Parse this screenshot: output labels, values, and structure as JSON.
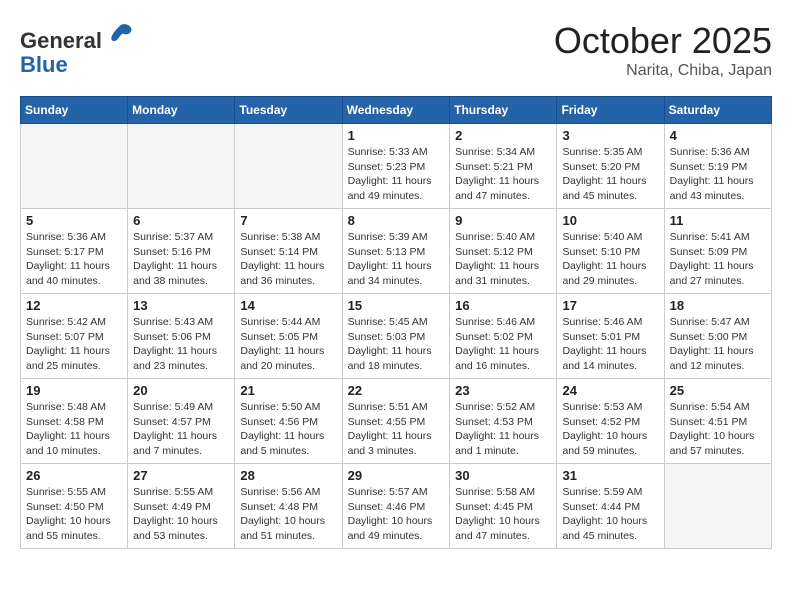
{
  "header": {
    "logo_general": "General",
    "logo_blue": "Blue",
    "month_title": "October 2025",
    "location": "Narita, Chiba, Japan"
  },
  "days_of_week": [
    "Sunday",
    "Monday",
    "Tuesday",
    "Wednesday",
    "Thursday",
    "Friday",
    "Saturday"
  ],
  "weeks": [
    [
      {
        "day": "",
        "info": ""
      },
      {
        "day": "",
        "info": ""
      },
      {
        "day": "",
        "info": ""
      },
      {
        "day": "1",
        "info": "Sunrise: 5:33 AM\nSunset: 5:23 PM\nDaylight: 11 hours\nand 49 minutes."
      },
      {
        "day": "2",
        "info": "Sunrise: 5:34 AM\nSunset: 5:21 PM\nDaylight: 11 hours\nand 47 minutes."
      },
      {
        "day": "3",
        "info": "Sunrise: 5:35 AM\nSunset: 5:20 PM\nDaylight: 11 hours\nand 45 minutes."
      },
      {
        "day": "4",
        "info": "Sunrise: 5:36 AM\nSunset: 5:19 PM\nDaylight: 11 hours\nand 43 minutes."
      }
    ],
    [
      {
        "day": "5",
        "info": "Sunrise: 5:36 AM\nSunset: 5:17 PM\nDaylight: 11 hours\nand 40 minutes."
      },
      {
        "day": "6",
        "info": "Sunrise: 5:37 AM\nSunset: 5:16 PM\nDaylight: 11 hours\nand 38 minutes."
      },
      {
        "day": "7",
        "info": "Sunrise: 5:38 AM\nSunset: 5:14 PM\nDaylight: 11 hours\nand 36 minutes."
      },
      {
        "day": "8",
        "info": "Sunrise: 5:39 AM\nSunset: 5:13 PM\nDaylight: 11 hours\nand 34 minutes."
      },
      {
        "day": "9",
        "info": "Sunrise: 5:40 AM\nSunset: 5:12 PM\nDaylight: 11 hours\nand 31 minutes."
      },
      {
        "day": "10",
        "info": "Sunrise: 5:40 AM\nSunset: 5:10 PM\nDaylight: 11 hours\nand 29 minutes."
      },
      {
        "day": "11",
        "info": "Sunrise: 5:41 AM\nSunset: 5:09 PM\nDaylight: 11 hours\nand 27 minutes."
      }
    ],
    [
      {
        "day": "12",
        "info": "Sunrise: 5:42 AM\nSunset: 5:07 PM\nDaylight: 11 hours\nand 25 minutes."
      },
      {
        "day": "13",
        "info": "Sunrise: 5:43 AM\nSunset: 5:06 PM\nDaylight: 11 hours\nand 23 minutes."
      },
      {
        "day": "14",
        "info": "Sunrise: 5:44 AM\nSunset: 5:05 PM\nDaylight: 11 hours\nand 20 minutes."
      },
      {
        "day": "15",
        "info": "Sunrise: 5:45 AM\nSunset: 5:03 PM\nDaylight: 11 hours\nand 18 minutes."
      },
      {
        "day": "16",
        "info": "Sunrise: 5:46 AM\nSunset: 5:02 PM\nDaylight: 11 hours\nand 16 minutes."
      },
      {
        "day": "17",
        "info": "Sunrise: 5:46 AM\nSunset: 5:01 PM\nDaylight: 11 hours\nand 14 minutes."
      },
      {
        "day": "18",
        "info": "Sunrise: 5:47 AM\nSunset: 5:00 PM\nDaylight: 11 hours\nand 12 minutes."
      }
    ],
    [
      {
        "day": "19",
        "info": "Sunrise: 5:48 AM\nSunset: 4:58 PM\nDaylight: 11 hours\nand 10 minutes."
      },
      {
        "day": "20",
        "info": "Sunrise: 5:49 AM\nSunset: 4:57 PM\nDaylight: 11 hours\nand 7 minutes."
      },
      {
        "day": "21",
        "info": "Sunrise: 5:50 AM\nSunset: 4:56 PM\nDaylight: 11 hours\nand 5 minutes."
      },
      {
        "day": "22",
        "info": "Sunrise: 5:51 AM\nSunset: 4:55 PM\nDaylight: 11 hours\nand 3 minutes."
      },
      {
        "day": "23",
        "info": "Sunrise: 5:52 AM\nSunset: 4:53 PM\nDaylight: 11 hours\nand 1 minute."
      },
      {
        "day": "24",
        "info": "Sunrise: 5:53 AM\nSunset: 4:52 PM\nDaylight: 10 hours\nand 59 minutes."
      },
      {
        "day": "25",
        "info": "Sunrise: 5:54 AM\nSunset: 4:51 PM\nDaylight: 10 hours\nand 57 minutes."
      }
    ],
    [
      {
        "day": "26",
        "info": "Sunrise: 5:55 AM\nSunset: 4:50 PM\nDaylight: 10 hours\nand 55 minutes."
      },
      {
        "day": "27",
        "info": "Sunrise: 5:55 AM\nSunset: 4:49 PM\nDaylight: 10 hours\nand 53 minutes."
      },
      {
        "day": "28",
        "info": "Sunrise: 5:56 AM\nSunset: 4:48 PM\nDaylight: 10 hours\nand 51 minutes."
      },
      {
        "day": "29",
        "info": "Sunrise: 5:57 AM\nSunset: 4:46 PM\nDaylight: 10 hours\nand 49 minutes."
      },
      {
        "day": "30",
        "info": "Sunrise: 5:58 AM\nSunset: 4:45 PM\nDaylight: 10 hours\nand 47 minutes."
      },
      {
        "day": "31",
        "info": "Sunrise: 5:59 AM\nSunset: 4:44 PM\nDaylight: 10 hours\nand 45 minutes."
      },
      {
        "day": "",
        "info": ""
      }
    ]
  ]
}
